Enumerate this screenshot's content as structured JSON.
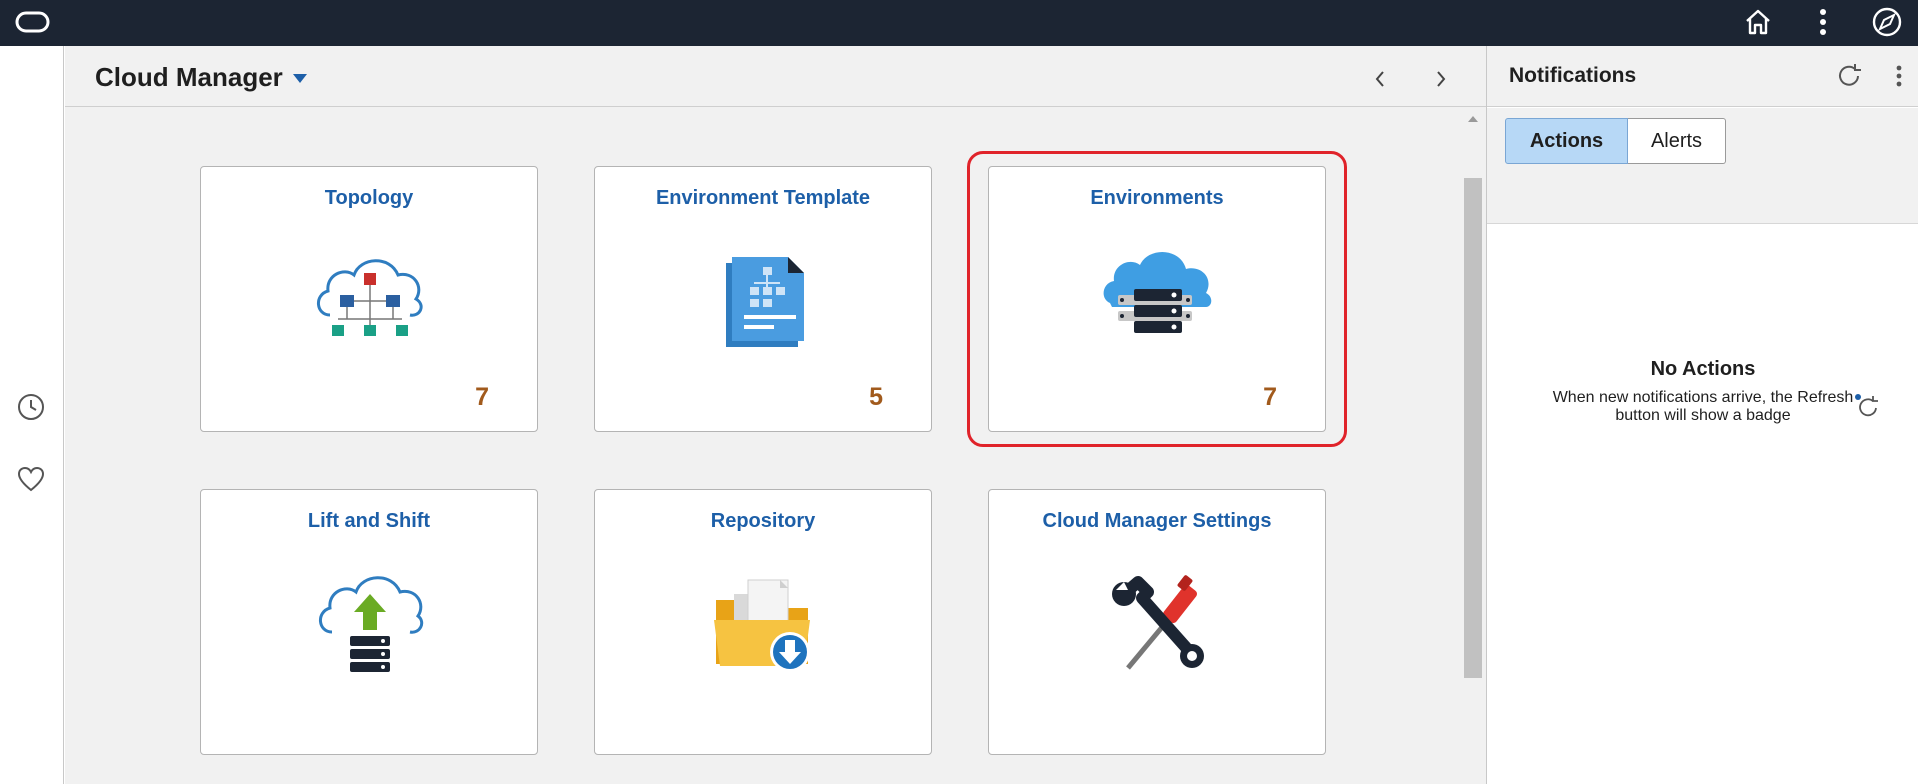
{
  "app": {
    "title": "Cloud Manager"
  },
  "colors": {
    "topbar": "#1c2533",
    "tile_title": "#1d5fa8",
    "tile_count": "#a15a1c",
    "highlight": "#e0232a",
    "active_tab": "#b7d8f6"
  },
  "topbar": {
    "icons": [
      "oracle-logo-icon",
      "home-icon",
      "more-vert-icon",
      "navigator-compass-icon"
    ]
  },
  "leftrail": {
    "icons": [
      "recent-clock-icon",
      "favorites-heart-icon"
    ]
  },
  "tiles": [
    {
      "title": "Topology",
      "count": "7",
      "icon": "topology-cloud-icon"
    },
    {
      "title": "Environment Template",
      "count": "5",
      "icon": "template-document-icon"
    },
    {
      "title": "Environments",
      "count": "7",
      "icon": "environments-cloud-server-icon",
      "highlighted": true
    },
    {
      "title": "Lift and Shift",
      "count": "",
      "icon": "lift-shift-upload-icon"
    },
    {
      "title": "Repository",
      "count": "",
      "icon": "repository-folder-icon"
    },
    {
      "title": "Cloud Manager Settings",
      "count": "",
      "icon": "settings-tools-icon"
    }
  ],
  "notifications": {
    "title": "Notifications",
    "tabs": [
      {
        "label": "Actions",
        "active": true
      },
      {
        "label": "Alerts",
        "active": false
      }
    ],
    "empty": {
      "title": "No Actions",
      "message": "When new notifications arrive, the Refresh button will show a badge"
    }
  }
}
